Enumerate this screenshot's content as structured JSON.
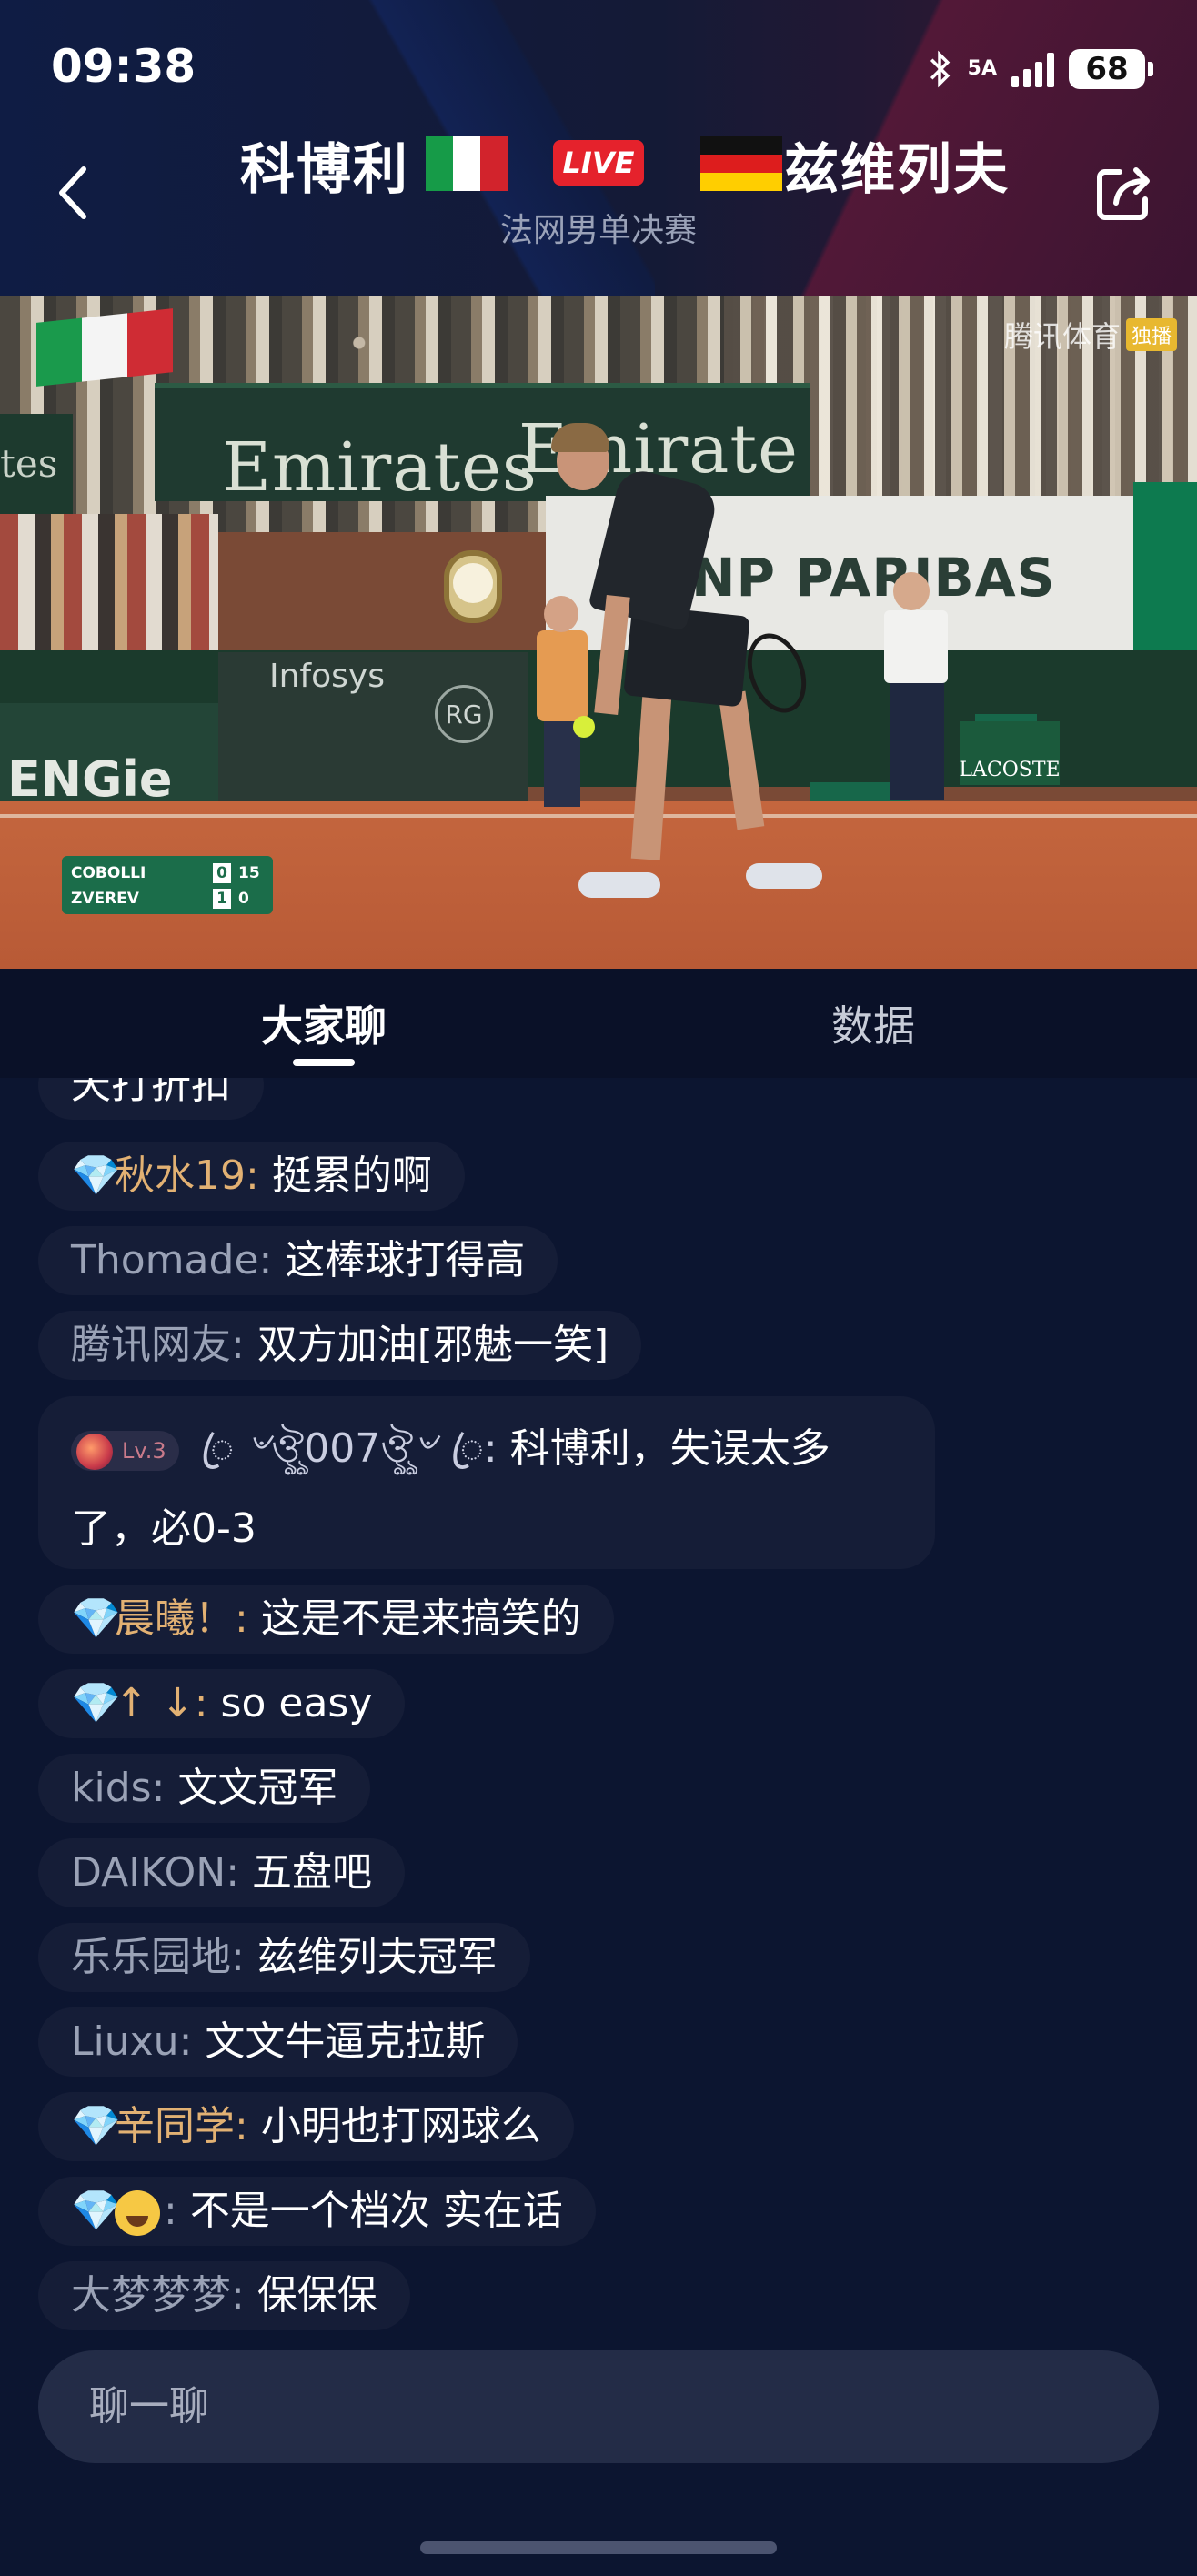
{
  "status_bar": {
    "time": "09:38",
    "network": "5A",
    "battery": "68"
  },
  "header": {
    "player_left": "科博利",
    "live_label": "LIVE",
    "player_right": "兹维列夫",
    "subtitle": "法网男单决赛",
    "colors": {
      "live": "#e5222c"
    }
  },
  "video": {
    "watermark": "腾讯体育",
    "watermark_tag": "独播",
    "scoreboard": [
      {
        "name": "COBOLLI",
        "sets": "0",
        "points": "15"
      },
      {
        "name": "ZVEREV",
        "sets": "1",
        "points": "0"
      }
    ],
    "signage": {
      "emirates": "Emirates",
      "emirates2": "Emirate",
      "bnp": "NP PARIBAS",
      "engie": "ENGie",
      "infosys": "Infosys",
      "lacoste": "LACOSTE",
      "left_wall": "tes"
    }
  },
  "tabs": {
    "chat": "大家聊",
    "data": "数据"
  },
  "chat": {
    "partial_top": "天打折扣",
    "messages": [
      {
        "user": "秋水19",
        "text": "挺累的啊",
        "vip": true
      },
      {
        "user": "Thomade",
        "text": "这棒球打得高",
        "vip": false
      },
      {
        "user": "腾讯网友",
        "text": "双方加油[邪魅一笑]",
        "vip": false
      },
      {
        "user": "晨曦！",
        "text": "这是不是来搞笑的",
        "vip": true
      },
      {
        "user": "↑ ↓",
        "text": "so easy",
        "vip": true
      },
      {
        "user": "kids",
        "text": "文文冠军",
        "vip": false
      },
      {
        "user": "DAIKON",
        "text": "五盘吧",
        "vip": false
      },
      {
        "user": "乐乐园地",
        "text": "兹维列夫冠军",
        "vip": false
      },
      {
        "user": "Liuxu",
        "text": "文文牛逼克拉斯",
        "vip": false
      },
      {
        "user": "辛同学",
        "text": "小明也打网球么",
        "vip": true
      },
      {
        "user": "",
        "text": "不是一个档次  实在话",
        "vip": true
      },
      {
        "user": "大梦梦梦",
        "text": "保保保",
        "vip": false
      }
    ],
    "long_message": {
      "level": "Lv.3",
      "user": "ꦿ︎ ৺ঔৣ007ঔৣ৺ ꦿ︎",
      "text": "科博利，失误太多了，必0-3"
    },
    "input_placeholder": "聊一聊"
  }
}
